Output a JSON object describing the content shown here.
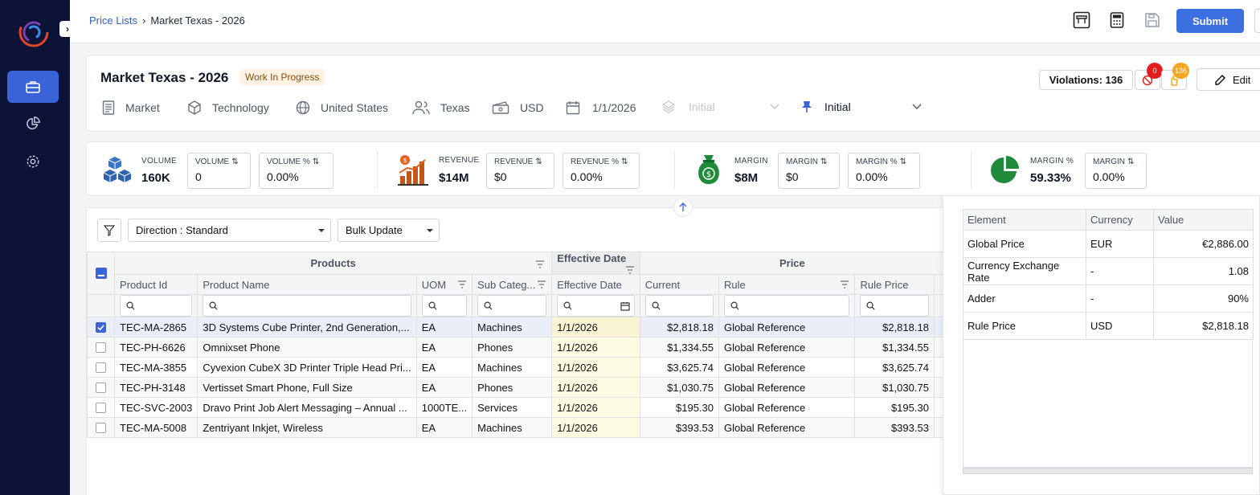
{
  "breadcrumb": {
    "parent": "Price Lists",
    "separator": "›",
    "current": "Market Texas - 2026"
  },
  "topbar": {
    "submit_label": "Submit"
  },
  "header": {
    "title": "Market Texas - 2026",
    "status": "Work In Progress",
    "meta": [
      {
        "icon": "document-icon",
        "label": "Market"
      },
      {
        "icon": "cube-icon",
        "label": "Technology"
      },
      {
        "icon": "globe-icon",
        "label": "United States"
      },
      {
        "icon": "users-icon",
        "label": "Texas"
      },
      {
        "icon": "money-icon",
        "label": "USD"
      },
      {
        "icon": "calendar-icon",
        "label": "1/1/2026"
      }
    ],
    "version_disabled": "Initial",
    "version_selected": "Initial",
    "violations_label": "Violations: 136",
    "badge_red": "0",
    "badge_orange": "136",
    "edit_label": "Edit"
  },
  "metrics": {
    "volume": {
      "label": "VOLUME",
      "value": "160K",
      "box1_label": "VOLUME",
      "box1_value": "0",
      "box2_label": "VOLUME %",
      "box2_value": "0.00%"
    },
    "revenue": {
      "label": "REVENUE",
      "value": "$14M",
      "box1_label": "REVENUE",
      "box1_value": "$0",
      "box2_label": "REVENUE %",
      "box2_value": "0.00%"
    },
    "margin": {
      "label": "MARGIN",
      "value": "$8M",
      "box1_label": "MARGIN",
      "box1_value": "$0",
      "box2_label": "MARGIN %",
      "box2_value": "0.00%"
    },
    "margin_pct": {
      "label": "MARGIN %",
      "value": "59.33%",
      "box1_label": "MARGIN",
      "box1_value": "0.00%"
    }
  },
  "toolbar": {
    "direction": "Direction : Standard",
    "bulk": "Bulk Update"
  },
  "grid": {
    "groups": {
      "products": "Products",
      "effective": "Effective Date",
      "price": "Price"
    },
    "columns": {
      "product_id": "Product Id",
      "product_name": "Product Name",
      "uom": "UOM",
      "sub_category": "Sub Categ...",
      "effective_date": "Effective Date",
      "current": "Current",
      "rule": "Rule",
      "rule_price": "Rule Price"
    },
    "rows": [
      {
        "id": "TEC-MA-2865",
        "name": "3D Systems Cube Printer, 2nd Generation,...",
        "uom": "EA",
        "sub": "Machines",
        "date": "1/1/2026",
        "current": "$2,818.18",
        "rule": "Global Reference",
        "rule_price": "$2,818.18"
      },
      {
        "id": "TEC-PH-6626",
        "name": "Omnixset Phone",
        "uom": "EA",
        "sub": "Phones",
        "date": "1/1/2026",
        "current": "$1,334.55",
        "rule": "Global Reference",
        "rule_price": "$1,334.55"
      },
      {
        "id": "TEC-MA-3855",
        "name": "Cyvexion CubeX 3D Printer Triple Head Pri...",
        "uom": "EA",
        "sub": "Machines",
        "date": "1/1/2026",
        "current": "$3,625.74",
        "rule": "Global Reference",
        "rule_price": "$3,625.74"
      },
      {
        "id": "TEC-PH-3148",
        "name": "Vertisset Smart Phone, Full Size",
        "uom": "EA",
        "sub": "Phones",
        "date": "1/1/2026",
        "current": "$1,030.75",
        "rule": "Global Reference",
        "rule_price": "$1,030.75"
      },
      {
        "id": "TEC-SVC-2003",
        "name": "Dravo Print Job Alert Messaging – Annual ...",
        "uom": "1000TE...",
        "sub": "Services",
        "date": "1/1/2026",
        "current": "$195.30",
        "rule": "Global Reference",
        "rule_price": "$195.30"
      },
      {
        "id": "TEC-MA-5008",
        "name": "Zentriyant Inkjet, Wireless",
        "uom": "EA",
        "sub": "Machines",
        "date": "1/1/2026",
        "current": "$393.53",
        "rule": "Global Reference",
        "rule_price": "$393.53"
      }
    ]
  },
  "panel": {
    "headers": {
      "element": "Element",
      "currency": "Currency",
      "value": "Value"
    },
    "rows": [
      {
        "element": "Global Price",
        "currency": "EUR",
        "value": "€2,886.00"
      },
      {
        "element": "Currency Exchange Rate",
        "currency": "-",
        "value": "1.08"
      },
      {
        "element": "Adder",
        "currency": "-",
        "value": "90%"
      },
      {
        "element": "Rule Price",
        "currency": "USD",
        "value": "$2,818.18"
      }
    ]
  },
  "colors": {
    "sidebar": "#0d1337",
    "accent": "#3b63d8",
    "badge_red": "#e11d1d",
    "badge_orange": "#f5a623"
  }
}
